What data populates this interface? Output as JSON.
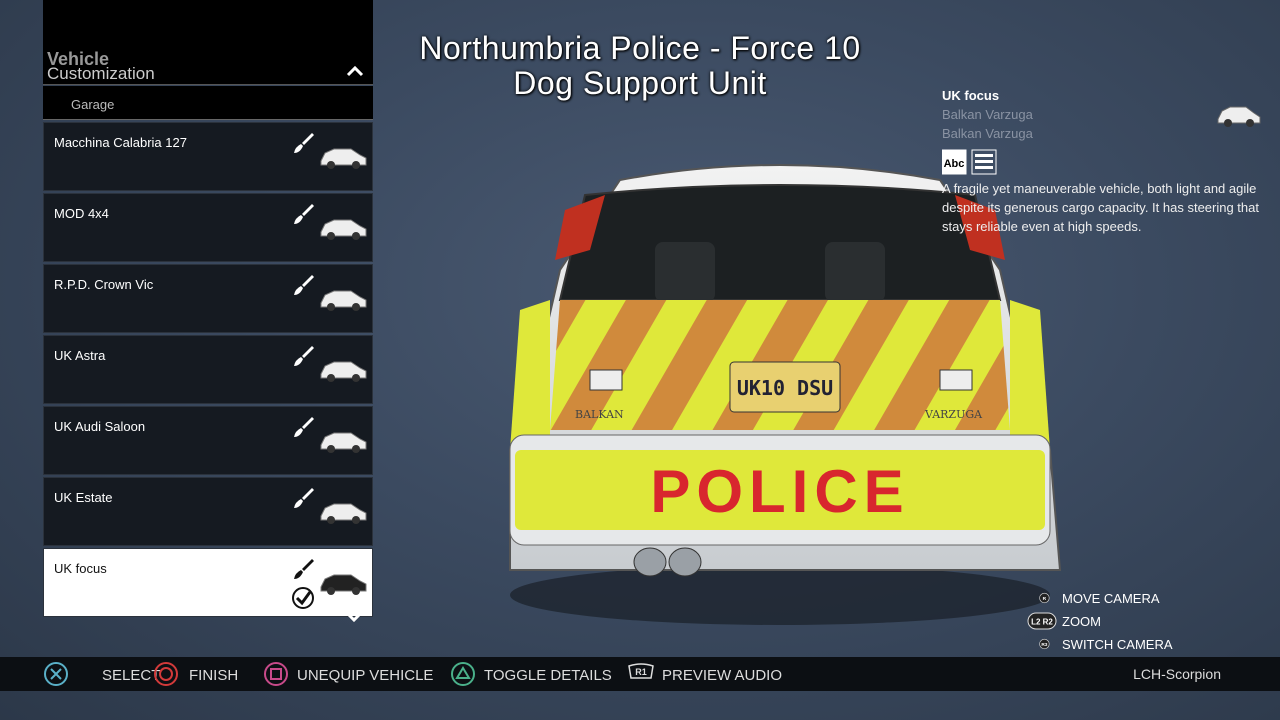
{
  "menu": {
    "title_line1": "Vehicle",
    "title_line2": "Customization",
    "section": "Garage",
    "items": [
      {
        "label": "Macchina Calabria 127",
        "selected": false
      },
      {
        "label": "MOD 4x4",
        "selected": false
      },
      {
        "label": "R.P.D. Crown Vic",
        "selected": false
      },
      {
        "label": "UK Astra",
        "selected": false
      },
      {
        "label": "UK Audi Saloon",
        "selected": false
      },
      {
        "label": "UK Estate",
        "selected": false
      },
      {
        "label": "UK focus",
        "selected": true
      }
    ]
  },
  "header": {
    "line1": "Northumbria Police - Force 10",
    "line2": "Dog Support Unit"
  },
  "details": {
    "name": "UK focus",
    "make": "Balkan Varzuga",
    "model": "Balkan Varzuga",
    "description": "A fragile yet maneuverable vehicle, both light and agile despite its generous cargo capacity. It has steering that stays reliable even at high speeds.",
    "icon_badge": "Abc"
  },
  "car_markings": {
    "plate": "UK10 DSU",
    "word": "POLICE",
    "make_badge": "BALKAN",
    "model_badge": "VARZUGA"
  },
  "camera_controls": [
    {
      "button": "R",
      "label": "MOVE CAMERA"
    },
    {
      "button": "L2 R2",
      "label": "ZOOM"
    },
    {
      "button": "R3",
      "label": "SWITCH CAMERA"
    }
  ],
  "hints": [
    {
      "icon": "cross-icon",
      "label": "SELECT"
    },
    {
      "icon": "circle-icon",
      "label": "FINISH"
    },
    {
      "icon": "square-icon",
      "label": "UNEQUIP VEHICLE"
    },
    {
      "icon": "triangle-icon",
      "label": "TOGGLE DETAILS"
    },
    {
      "icon": "r1-icon",
      "button": "R1",
      "label": "PREVIEW AUDIO"
    }
  ],
  "user": "LCH-Scorpion",
  "colors": {
    "cross": "#5ab0c8",
    "circle": "#d23a3a",
    "square": "#c84a8a",
    "triangle": "#4ab08a",
    "hi_vis_yellow": "#dfe83a",
    "chevron_orange": "#d08a3c",
    "police_red": "#d8262e"
  }
}
